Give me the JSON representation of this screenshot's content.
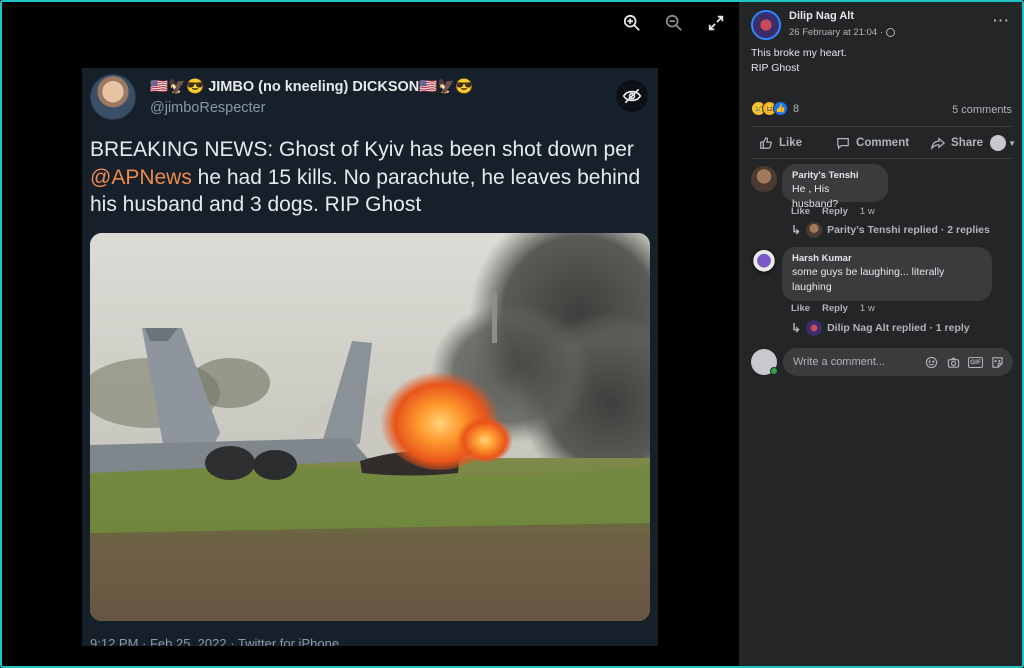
{
  "viewer": {
    "tools": [
      "zoom-in-icon",
      "zoom-out-icon",
      "fullscreen-icon"
    ]
  },
  "tweet": {
    "display_name": "🇺🇸🦅😎 JIMBO (no kneeling) DICKSON🇺🇸🦅😎",
    "handle": "@jimboRespecter",
    "text_before_mention": "BREAKING NEWS: Ghost of Kyiv has been shot down per ",
    "mention": "@APNews",
    "text_after_mention": " he had 15 kills. No parachute, he leaves behind his husband and 3 dogs. RIP Ghost",
    "footer": "9:12 PM · Feb 25, 2022 · Twitter for iPhone",
    "mention_color": "#f08a4a",
    "background_color": "#15202b"
  },
  "post": {
    "author": "Dilip Nag Alt",
    "timestamp": "26 February at 21:04 ·",
    "text_line1": "This broke my heart.",
    "text_line2": "RIP Ghost",
    "reaction_count": "8",
    "comments_count": "5 comments",
    "actions": {
      "like": "Like",
      "comment": "Comment",
      "share": "Share"
    }
  },
  "comments": [
    {
      "name": "Parity's Tenshi",
      "text": "He , His husband?",
      "like": "Like",
      "reply": "Reply",
      "age": "1 w",
      "replies_summary": "Parity's Tenshi replied · 2 replies"
    },
    {
      "name": "Harsh Kumar",
      "text": "some guys be laughing... literally laughing",
      "like": "Like",
      "reply": "Reply",
      "age": "1 w",
      "replies_summary": "Dilip Nag Alt replied · 1 reply"
    }
  ],
  "composer": {
    "placeholder": "Write a comment..."
  },
  "colors": {
    "frame": "#1ec5c5",
    "panel": "#242526",
    "bubble": "#3a3b3c",
    "link_blue": "#1877f2"
  }
}
